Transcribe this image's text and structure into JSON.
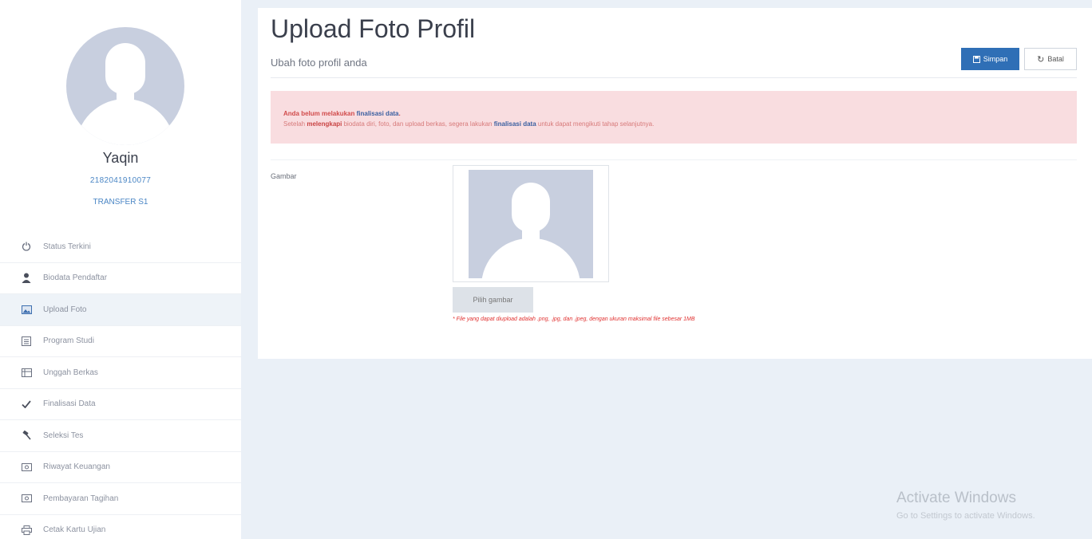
{
  "profile": {
    "name": "Yaqin",
    "id": "2182041910077",
    "path": "TRANSFER S1"
  },
  "menu": {
    "items": [
      {
        "label": "Status Terkini",
        "icon": "power-icon"
      },
      {
        "label": "Biodata Pendaftar",
        "icon": "user-icon"
      },
      {
        "label": "Upload Foto",
        "icon": "picture-icon"
      },
      {
        "label": "Program Studi",
        "icon": "book-icon"
      },
      {
        "label": "Unggah Berkas",
        "icon": "files-icon"
      },
      {
        "label": "Finalisasi Data",
        "icon": "check-icon"
      },
      {
        "label": "Seleksi Tes",
        "icon": "gavel-icon"
      },
      {
        "label": "Riwayat Keuangan",
        "icon": "money-icon"
      },
      {
        "label": "Pembayaran Tagihan",
        "icon": "bill-icon"
      },
      {
        "label": "Cetak Kartu Ujian",
        "icon": "print-icon"
      }
    ],
    "active_index": 2
  },
  "header": {
    "title": "Upload Foto Profil",
    "subtitle": "Ubah foto profil anda",
    "save_label": "Simpan",
    "reset_label": "Batal"
  },
  "alert": {
    "line1_text": "Anda belum melakukan ",
    "line1_link": "finalisasi data",
    "line1_end": ".",
    "line2_pre": "Setelah ",
    "line2_bold": "melengkapi",
    "line2_mid": " biodata diri, foto, dan upload berkas, segera lakukan ",
    "line2_link": "finalisasi data",
    "line2_end": " untuk dapat mengikuti tahap selanjutnya."
  },
  "form": {
    "field_label": "Gambar",
    "choose_label": "Pilih gambar",
    "hint": "* File yang dapat diupload adalah .png, .jpg, dan .jpeg, dengan ukuran maksimal file sebesar 1MB"
  },
  "watermark": {
    "title": "Activate Windows",
    "subtitle": "Go to Settings to activate Windows."
  },
  "colors": {
    "primary": "#2f6fb6",
    "alert_bg": "#f9dde0",
    "alert_text": "#d14b4b",
    "avatar_bg": "#c8cfdf",
    "page_bg": "#eaf0f7"
  }
}
